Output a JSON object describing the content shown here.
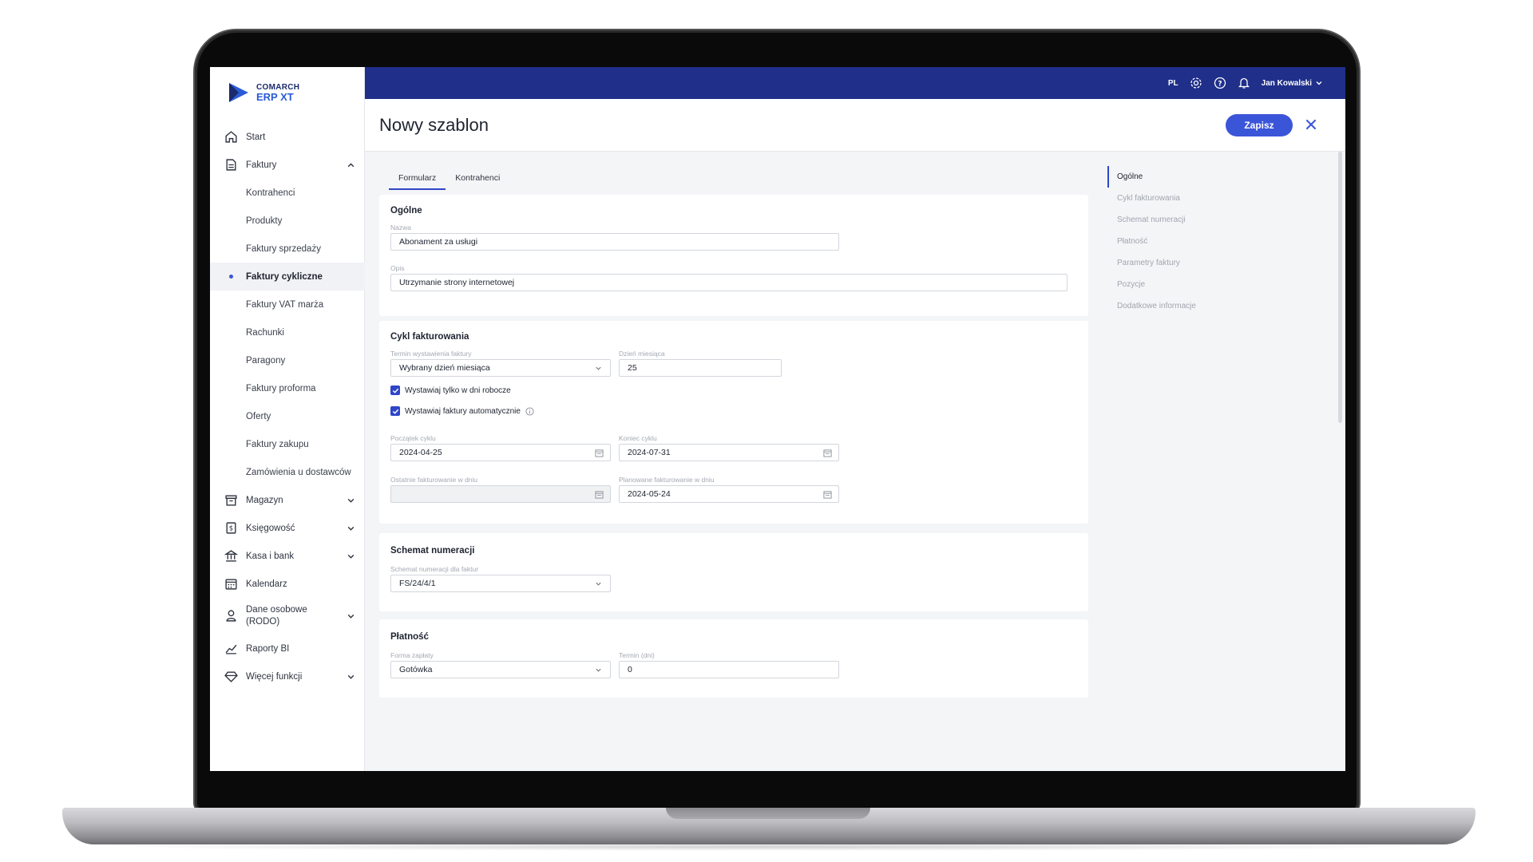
{
  "app": {
    "logo_top": "COMARCH",
    "logo_bottom": "ERP XT"
  },
  "topbar": {
    "language": "PL",
    "user_name": "Jan Kowalski"
  },
  "sidebar": {
    "items": [
      {
        "label": "Start"
      },
      {
        "label": "Faktury"
      },
      {
        "label": "Kontrahenci"
      },
      {
        "label": "Produkty"
      },
      {
        "label": "Faktury sprzedaży"
      },
      {
        "label": "Faktury cykliczne"
      },
      {
        "label": "Faktury VAT marża"
      },
      {
        "label": "Rachunki"
      },
      {
        "label": "Paragony"
      },
      {
        "label": "Faktury proforma"
      },
      {
        "label": "Oferty"
      },
      {
        "label": "Faktury zakupu"
      },
      {
        "label": "Zamówienia u dostawców"
      },
      {
        "label": "Magazyn"
      },
      {
        "label": "Księgowość"
      },
      {
        "label": "Kasa i bank"
      },
      {
        "label": "Kalendarz"
      },
      {
        "label": "Dane osobowe (RODO)"
      },
      {
        "label": "Raporty BI"
      },
      {
        "label": "Więcej funkcji"
      }
    ]
  },
  "header": {
    "title": "Nowy szablon",
    "save_label": "Zapisz"
  },
  "tabs": [
    {
      "label": "Formularz"
    },
    {
      "label": "Kontrahenci"
    }
  ],
  "form": {
    "general": {
      "title": "Ogólne",
      "name_label": "Nazwa",
      "name_value": "Abonament za usługi",
      "desc_label": "Opis",
      "desc_value": "Utrzymanie strony internetowej"
    },
    "cycle": {
      "title": "Cykl fakturowania",
      "term_label": "Termin wystawienia faktury",
      "term_value": "Wybrany dzień miesiąca",
      "day_label": "Dzień miesiąca",
      "day_value": "25",
      "check1": "Wystawiaj tylko w dni robocze",
      "check2": "Wystawiaj faktury automatycznie",
      "start_label": "Początek cyklu",
      "start_value": "2024-04-25",
      "end_label": "Koniec cyklu",
      "end_value": "2024-07-31",
      "last_label": "Ostatnie fakturowanie w dniu",
      "last_value": "",
      "planned_label": "Planowane fakturowanie w dniu",
      "planned_value": "2024-05-24"
    },
    "numbering": {
      "title": "Schemat numeracji",
      "scheme_label": "Schemat numeracji dla faktur",
      "scheme_value": "FS/24/4/1"
    },
    "payment": {
      "title": "Płatność",
      "method_label": "Forma zapłaty",
      "method_value": "Gotówka",
      "term_label": "Termin (dni)",
      "term_value": "0"
    }
  },
  "anchor_menu": [
    {
      "label": "Ogólne"
    },
    {
      "label": "Cykl fakturowania"
    },
    {
      "label": "Schemat numeracji"
    },
    {
      "label": "Płatność"
    },
    {
      "label": "Parametry faktury"
    },
    {
      "label": "Pozycje"
    },
    {
      "label": "Dodatkowe informacje"
    }
  ],
  "colors": {
    "topbar": "#1f2f8a",
    "accent": "#3b55d9"
  }
}
